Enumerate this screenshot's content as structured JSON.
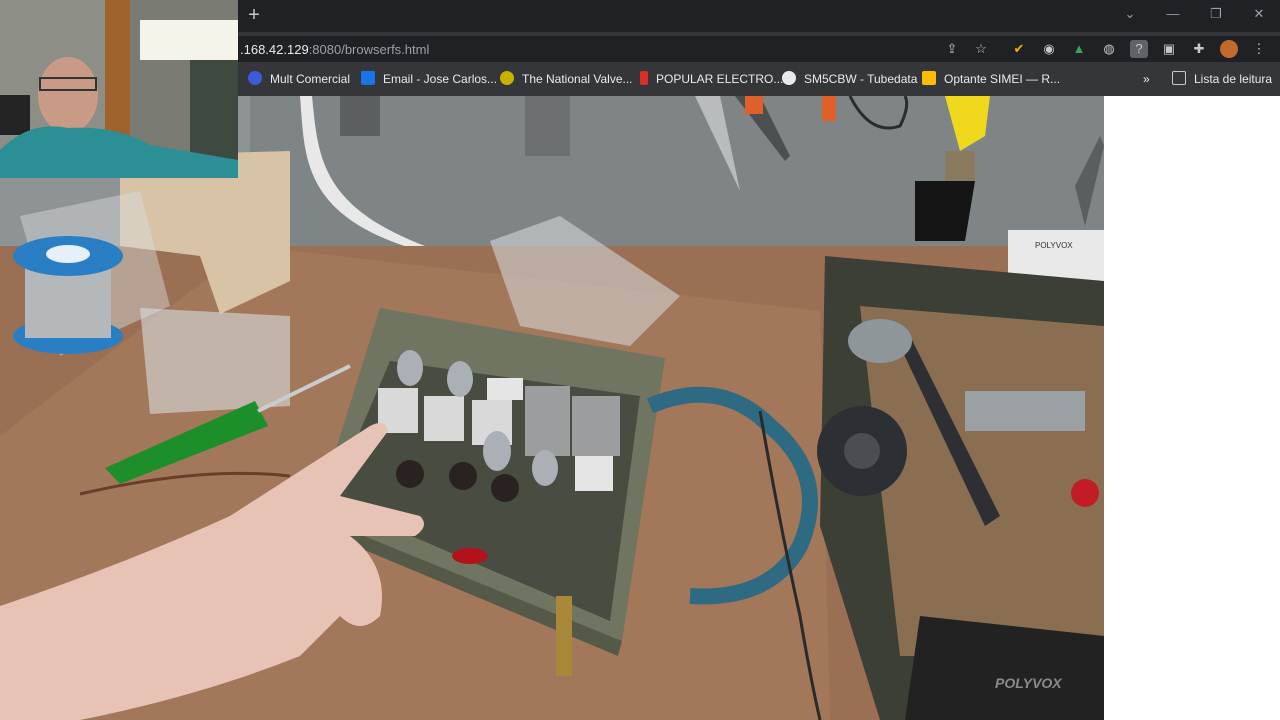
{
  "browser": {
    "new_tab_symbol": "+",
    "url_host": ".168.42.129",
    "url_rest": ":8080/browserfs.html",
    "window_controls": [
      "minimize-icon",
      "restore-icon",
      "close-icon"
    ],
    "toolbar_icons": [
      "share-icon",
      "star-icon",
      "extension-icon",
      "extension-icon",
      "drive-icon",
      "extension-icon",
      "help-icon",
      "extension-icon",
      "puzzle-icon",
      "avatar",
      "menu-icon"
    ]
  },
  "bookmarks": {
    "items": [
      {
        "label": "Mult Comercial",
        "color": "#3b5bdb"
      },
      {
        "label": "Email - Jose Carlos...",
        "color": "#1a73e8"
      },
      {
        "label": "The National Valve...",
        "color": "#c7b000"
      },
      {
        "label": "POPULAR ELECTRO...",
        "color": "#d93025"
      },
      {
        "label": "SM5CBW - Tubedata",
        "color": "#e8eaed"
      },
      {
        "label": "Optante SIMEI — R...",
        "color": "#fbbc04"
      }
    ],
    "more_symbol": "»",
    "reading_list": "Lista de leitura"
  },
  "photo": {
    "box_label": "POLYVOX",
    "device_label": "POLYVOX"
  }
}
